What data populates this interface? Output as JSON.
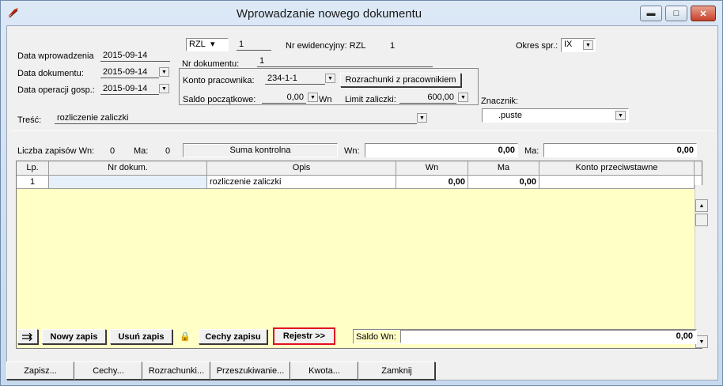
{
  "window": {
    "title": "Wprowadzanie nowego dokumentu",
    "minimize": "▬",
    "maximize": "□",
    "close": "✕"
  },
  "header": {
    "data_wprowadzenia_label": "Data wprowadzenia",
    "data_wprowadzenia": "2015-09-14",
    "data_dokumentu_label": "Data dokumentu:",
    "data_dokumentu": "2015-09-14",
    "data_operacji_label": "Data operacji gosp.:",
    "data_operacji": "2015-09-14",
    "typ": "RZL",
    "typ_num": "1",
    "nr_ewid_label": "Nr ewidencyjny: RZL",
    "nr_ewid": "1",
    "nr_dok_label": "Nr dokumentu:",
    "nr_dok": "1",
    "okres_label": "Okres spr.:",
    "okres": "IX",
    "konto_label": "Konto pracownika:",
    "konto": "234-1-1",
    "rozrachunki_btn": "Rozrachunki z pracownikiem",
    "saldo_pocz_label": "Saldo początkowe:",
    "saldo_pocz": "0,00",
    "saldo_pocz_unit": "Wn",
    "limit_label": "Limit zaliczki:",
    "limit": "600,00",
    "znacznik_label": "Znacznik:",
    "znacznik": ".puste",
    "tresc_label": "Treść:",
    "tresc": "rozliczenie zaliczki"
  },
  "summary": {
    "liczba_label": "Liczba zapisów Wn:",
    "liczba_wn": "0",
    "ma_label": "Ma:",
    "liczba_ma": "0",
    "suma_label": "Suma kontrolna",
    "wn_label": "Wn:",
    "suma_wn": "0,00",
    "ma2_label": "Ma:",
    "suma_ma": "0,00"
  },
  "table": {
    "columns": [
      "Lp.",
      "Nr dokum.",
      "Opis",
      "Wn",
      "Ma",
      "Konto przeciwstawne"
    ],
    "rows": [
      {
        "lp": "1",
        "nr": "",
        "opis": "rozliczenie zaliczki",
        "wn": "0,00",
        "ma": "0,00",
        "konto": ""
      }
    ]
  },
  "actions": {
    "nowy": "Nowy zapis",
    "usun": "Usuń zapis",
    "cechy_zapisu": "Cechy zapisu",
    "rejestr": "Rejestr >>",
    "saldo_label": "Saldo Wn:",
    "saldo": "0,00"
  },
  "bottom": [
    "Zapisz...",
    "Cechy...",
    "Rozrachunki...",
    "Przeszukiwanie...",
    "Kwota...",
    "Zamknij"
  ],
  "colors": {
    "grid_bg": "#ffffc6",
    "highlight": "#e01020"
  }
}
